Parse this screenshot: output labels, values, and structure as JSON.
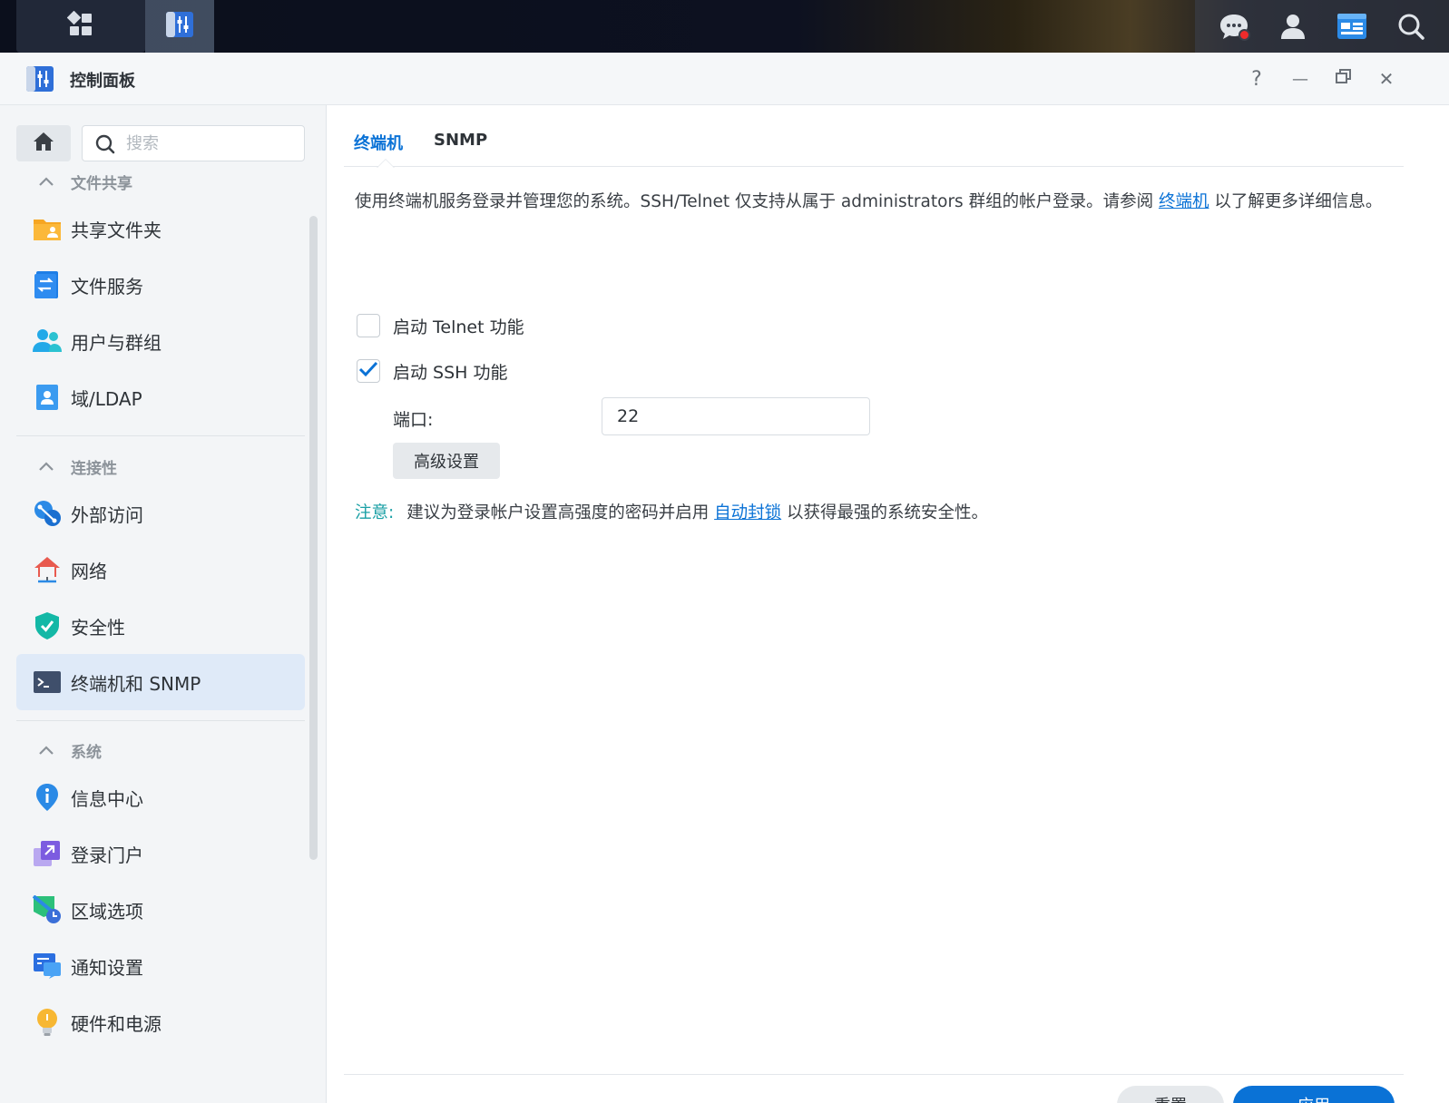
{
  "window": {
    "title": "控制面板",
    "help_glyph": "?",
    "minimize_glyph": "—",
    "close_glyph": "✕"
  },
  "sidebar": {
    "search_placeholder": "搜索",
    "groups": [
      {
        "label": "文件共享",
        "items": [
          {
            "label": "共享文件夹",
            "icon": "shared-folder-icon"
          },
          {
            "label": "文件服务",
            "icon": "file-services-icon"
          },
          {
            "label": "用户与群组",
            "icon": "users-groups-icon"
          },
          {
            "label": "域/LDAP",
            "icon": "domain-ldap-icon"
          }
        ]
      },
      {
        "label": "连接性",
        "items": [
          {
            "label": "外部访问",
            "icon": "external-access-icon"
          },
          {
            "label": "网络",
            "icon": "network-icon"
          },
          {
            "label": "安全性",
            "icon": "security-shield-icon"
          },
          {
            "label": "终端机和 SNMP",
            "icon": "terminal-icon",
            "active": true
          }
        ]
      },
      {
        "label": "系统",
        "items": [
          {
            "label": "信息中心",
            "icon": "info-center-icon"
          },
          {
            "label": "登录门户",
            "icon": "login-portal-icon"
          },
          {
            "label": "区域选项",
            "icon": "regional-options-icon"
          },
          {
            "label": "通知设置",
            "icon": "notification-icon"
          },
          {
            "label": "硬件和电源",
            "icon": "hardware-power-icon"
          }
        ]
      }
    ]
  },
  "main": {
    "tabs": [
      {
        "label": "终端机",
        "active": true
      },
      {
        "label": "SNMP",
        "active": false
      }
    ],
    "description_before": "使用终端机服务登录并管理您的系统。SSH/Telnet 仅支持从属于 administrators 群组的帐户登录。请参阅 ",
    "description_link": "终端机",
    "description_after": " 以了解更多详细信息。",
    "telnet_label": "启动 Telnet 功能",
    "telnet_checked": false,
    "ssh_label": "启动 SSH 功能",
    "ssh_checked": true,
    "port_label": "端口:",
    "port_value": "22",
    "advanced_label": "高级设置",
    "note_label": "注意:",
    "note_before": "建议为登录帐户设置高强度的密码并启用 ",
    "note_link": "自动封锁",
    "note_after": " 以获得最强的系统安全性。",
    "reset_label": "重置",
    "apply_label": "应用"
  },
  "colors": {
    "accent": "#0a72d6",
    "note": "#1aa0a5",
    "active_nav_bg": "#dfeaf8"
  }
}
